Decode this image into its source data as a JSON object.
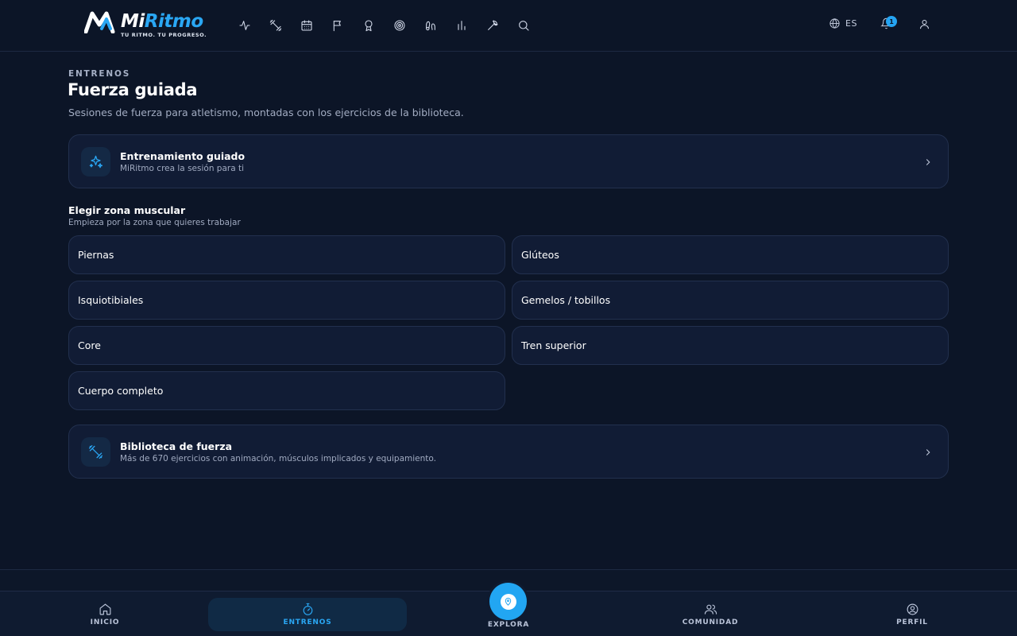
{
  "brand": {
    "name_part1": "Mi",
    "name_part2": "Ritmo",
    "tagline": "TU RITMO. TU PROGRESO.",
    "accent_color": "#2aa7f4"
  },
  "header": {
    "nav_icons": [
      "activity-icon",
      "dumbbell-icon",
      "calendar-icon",
      "flag-icon",
      "medal-icon",
      "target-icon",
      "footprints-icon",
      "bar-chart-icon",
      "wrench-icon",
      "search-icon"
    ],
    "language": "ES",
    "notifications_count": "1"
  },
  "page": {
    "eyebrow": "ENTRENOS",
    "title": "Fuerza guiada",
    "subtitle": "Sesiones de fuerza para atletismo, montadas con los ejercicios de la biblioteca."
  },
  "guided_card": {
    "title": "Entrenamiento guiado",
    "subtitle": "MiRitmo crea la sesión para ti"
  },
  "zones": {
    "title": "Elegir zona muscular",
    "subtitle": "Empieza por la zona que quieres trabajar",
    "items": [
      "Piernas",
      "Glúteos",
      "Isquiotibiales",
      "Gemelos / tobillos",
      "Core",
      "Tren superior",
      "Cuerpo completo"
    ]
  },
  "library_card": {
    "title": "Biblioteca de fuerza",
    "subtitle": "Más de 670 ejercicios con animación, músculos implicados y equipamiento."
  },
  "bottom_nav": {
    "inicio": "INICIO",
    "entrenos": "ENTRENOS",
    "explora": "EXPLORA",
    "comunidad": "COMUNIDAD",
    "perfil": "PERFIL"
  }
}
